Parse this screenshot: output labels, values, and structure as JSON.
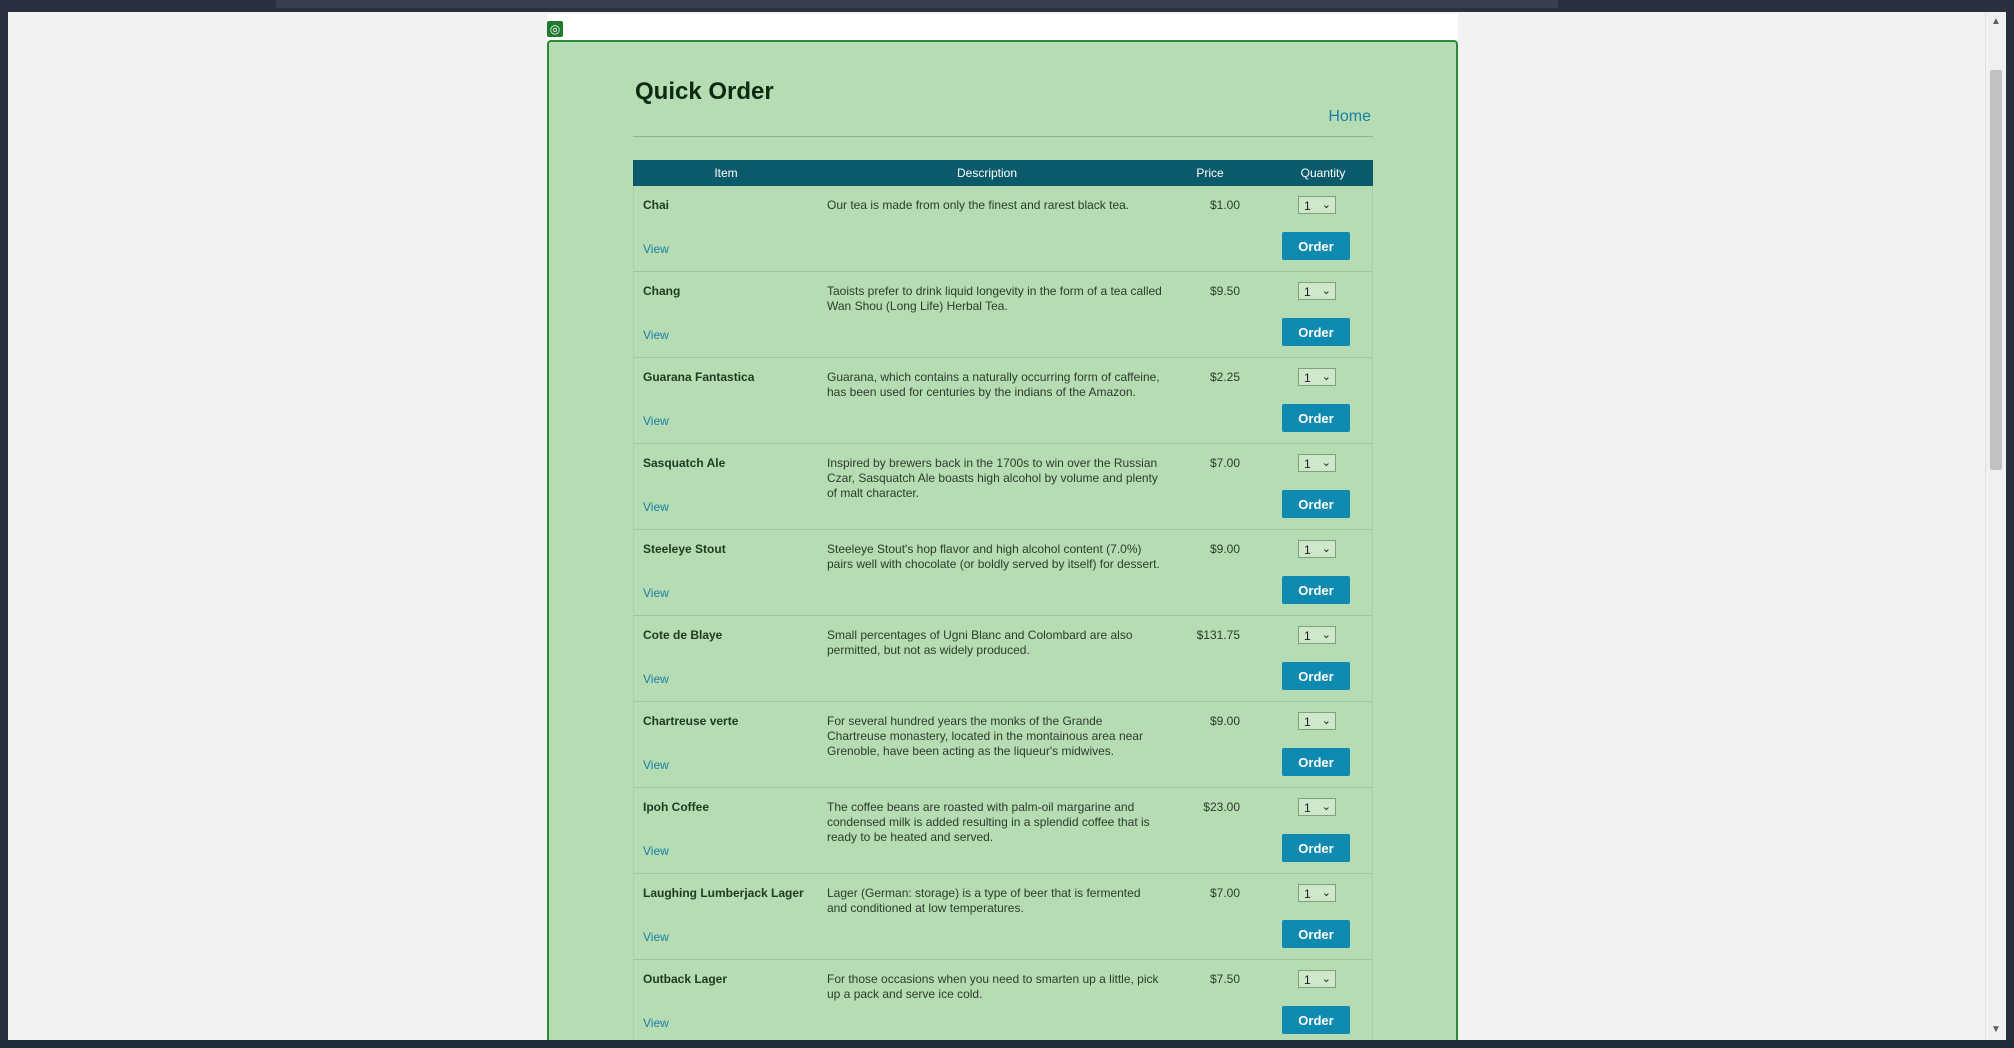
{
  "page": {
    "title": "Quick Order",
    "home_link": "Home",
    "admin_icon": "target-icon"
  },
  "table": {
    "headers": {
      "item": "Item",
      "description": "Description",
      "price": "Price",
      "quantity": "Quantity"
    },
    "view_label": "View",
    "order_label": "Order",
    "rows": [
      {
        "name": "Chai",
        "description": "Our tea is made from only the finest and rarest black tea.",
        "price": "$1.00",
        "qty": "1"
      },
      {
        "name": "Chang",
        "description": "Taoists prefer to drink liquid longevity in the form of a tea called Wan Shou (Long Life) Herbal Tea.",
        "price": "$9.50",
        "qty": "1"
      },
      {
        "name": "Guarana Fantastica",
        "description": "Guarana, which contains a naturally occurring form of caffeine, has been used for centuries by the indians of the Amazon.",
        "price": "$2.25",
        "qty": "1"
      },
      {
        "name": "Sasquatch Ale",
        "description": "Inspired by brewers back in the 1700s to win over the Russian Czar, Sasquatch Ale boasts high alcohol by volume and plenty of malt character.",
        "price": "$7.00",
        "qty": "1"
      },
      {
        "name": "Steeleye Stout",
        "description": "Steeleye Stout's hop flavor and high alcohol content (7.0%) pairs well with chocolate (or boldly served by itself) for dessert.",
        "price": "$9.00",
        "qty": "1"
      },
      {
        "name": "Cote de Blaye",
        "description": "Small percentages of Ugni Blanc and Colombard are also permitted, but not as widely produced.",
        "price": "$131.75",
        "qty": "1"
      },
      {
        "name": "Chartreuse verte",
        "description": "For several hundred years the monks of the Grande Chartreuse monastery, located in the montainous area near Grenoble, have been acting as the liqueur's midwives.",
        "price": "$9.00",
        "qty": "1"
      },
      {
        "name": "Ipoh Coffee",
        "description": "The coffee beans are roasted with palm-oil margarine and condensed milk is added resulting in a splendid coffee that is ready to be heated and served.",
        "price": "$23.00",
        "qty": "1"
      },
      {
        "name": "Laughing Lumberjack Lager",
        "description": "Lager (German: storage) is a type of beer that is fermented and conditioned at low temperatures.",
        "price": "$7.00",
        "qty": "1"
      },
      {
        "name": "Outback Lager",
        "description": "For those occasions when you need to smarten up a little, pick up a pack and serve ice cold.",
        "price": "$7.50",
        "qty": "1"
      }
    ]
  },
  "colors": {
    "panel_bg": "#b5dcb2",
    "header_bg": "#0b5a6b",
    "button_bg": "#0e8ab0",
    "link": "#1b7fa3"
  }
}
